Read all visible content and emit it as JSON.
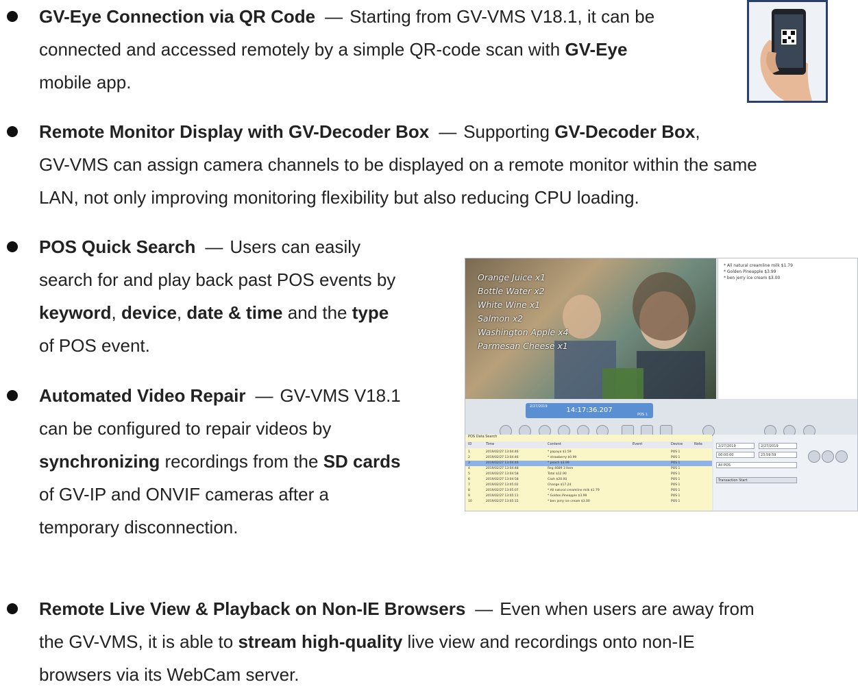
{
  "bullets": [
    {
      "title": "GV-Eye Connection via QR Code",
      "dash": "—",
      "text1": "Starting from GV-VMS V18.1, it can be",
      "text2": "connected and accessed remotely by a simple QR-code scan with ",
      "bold1": "GV-Eye",
      "text3": "mobile app."
    },
    {
      "title": "Remote Monitor Display with GV-Decoder Box",
      "dash": "—",
      "text1": "Supporting ",
      "bold1": "GV-Decoder Box",
      "text2": ",",
      "text3": "GV-VMS can assign camera channels to be displayed on a remote monitor within the same",
      "text4": "LAN, not only improving monitoring flexibility but also reducing CPU loading."
    },
    {
      "title": "POS Quick Search",
      "dash": "—",
      "text1": "Users can easily",
      "text2": "search for and play back past POS events by",
      "bold1": "keyword",
      "sep1": ", ",
      "bold2": "device",
      "sep2": ", ",
      "bold3": "date & time",
      "sep3": " and the ",
      "bold4": "type",
      "text3": "of POS event."
    },
    {
      "title": "Automated Video Repair",
      "dash": "—",
      "text1": "GV-VMS V18.1",
      "text2": "can be configured to repair videos by",
      "bold1": "synchronizing",
      "text3": " recordings from the ",
      "bold2": "SD cards",
      "text4": "of GV-IP and ONVIF cameras after a",
      "text5": "temporary disconnection."
    },
    {
      "title": "Remote Live View & Playback on Non-IE Browsers",
      "dash": "—",
      "text1": "Even when users are away from",
      "text2": "the GV-VMS, it is able to ",
      "bold1": "stream high-quality",
      "text3": " live view and recordings onto non-IE",
      "text4": "browsers via its WebCam server."
    }
  ],
  "pos_screenshot": {
    "overlay": [
      "Orange Juice x1",
      "Bottle Water x2",
      "White Wine x1",
      "Salmon x2",
      "Washington Apple x4",
      "Parmesan Cheese x1"
    ],
    "receipt": [
      "* All natural creamline milk $1.79",
      "* Golden Pineapple $3.99",
      "* ben jerry ice cream $3.00"
    ],
    "clock_time": "14:17:36.207",
    "clock_date": "2/27/2019",
    "clock_pos": "POS 1",
    "table_title": "POS Data Search",
    "headers": [
      "ID",
      "Time",
      "Content",
      "Event",
      "Device",
      "Note"
    ],
    "rows": [
      [
        "1",
        "2019/02/27 13:04:46",
        "* papaya $1.59",
        "POS 1"
      ],
      [
        "2",
        "2019/02/27 13:04:46",
        "* strawberry $0.99",
        "POS 1"
      ],
      [
        "3",
        "2019/02/27 13:04:46",
        "* peach $3.99",
        "POS 1"
      ],
      [
        "4",
        "2019/02/27 13:04:48",
        "Reg 4689 3 Item",
        "POS 1"
      ],
      [
        "5",
        "2019/02/27 13:04:58",
        "Total $12.90",
        "POS 1"
      ],
      [
        "6",
        "2019/02/27 13:04:58",
        "Cash $20.00",
        "POS 1"
      ],
      [
        "7",
        "2019/02/27 13:05:02",
        "Change $17.24",
        "POS 1"
      ],
      [
        "8",
        "2019/02/27 13:05:07",
        "* All natural creamline milk $1.79",
        "POS 1"
      ],
      [
        "9",
        "2019/02/27 13:05:11",
        "* Golden Pineapple $3.99",
        "POS 1"
      ],
      [
        "10",
        "2019/02/27 13:05:15",
        "* ben jerry ice cream $3.00",
        "POS 1"
      ]
    ],
    "date_from": "2/27/2019",
    "date_to": "2/27/2019",
    "time_from": "00:00:00",
    "time_to": "23:59:59",
    "device_select": "All POS",
    "transaction_start": "Transaction Start"
  }
}
